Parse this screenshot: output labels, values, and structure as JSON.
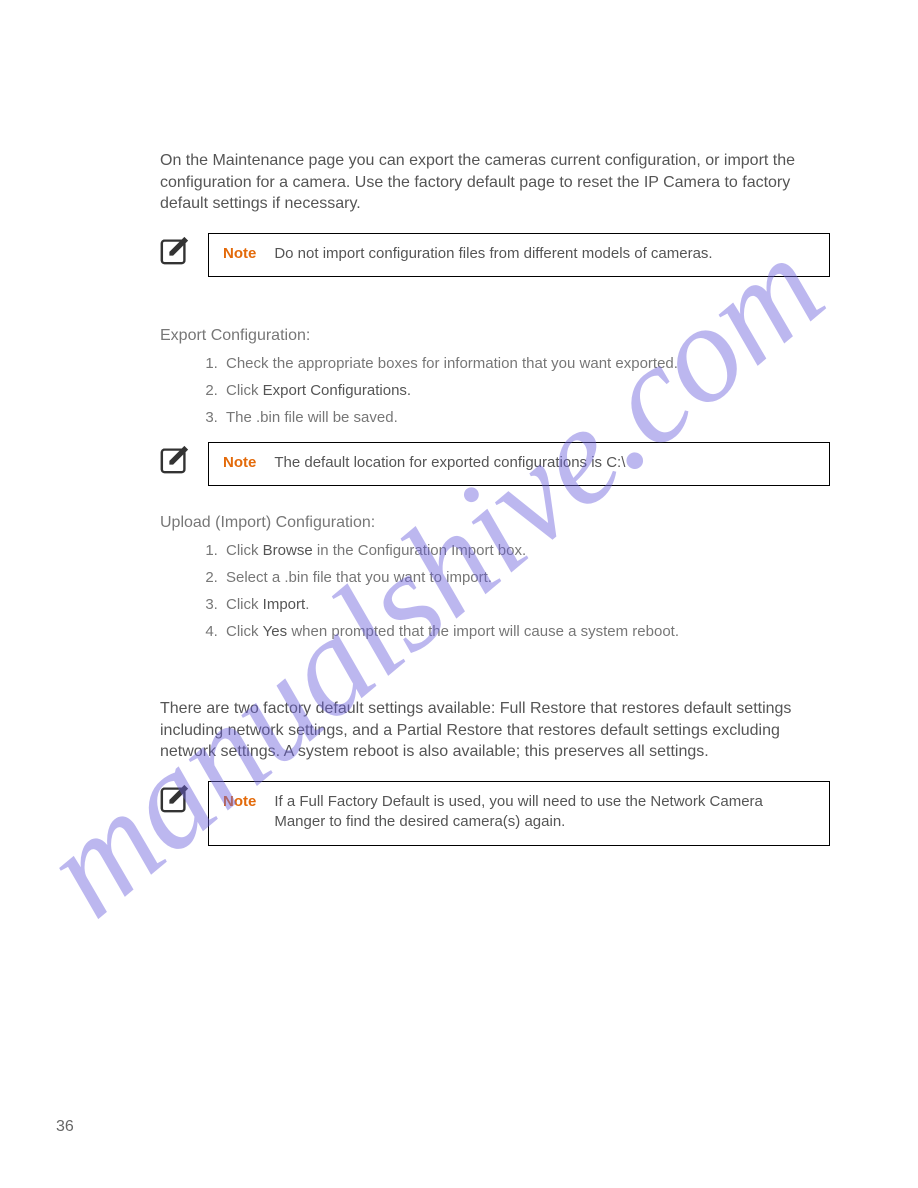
{
  "intro": "On the Maintenance page you can export the cameras current configuration, or import the configuration for a camera. Use the factory default page to reset the IP Camera to factory default settings if necessary.",
  "notes": {
    "label": "Note",
    "note1": "Do not import configuration files from different models of cameras.",
    "note2": "The default location for exported configurations is C:\\",
    "note3": "If a Full Factory Default is used, you will need to use the Network Camera Manger to find the desired camera(s) again."
  },
  "export": {
    "heading": "Export Configuration:",
    "steps": {
      "s1": "Check the appropriate boxes for information that you want exported.",
      "s2_prefix": "Click ",
      "s2_bold": "Export Configurations.",
      "s3": "The .bin file will be saved."
    }
  },
  "upload": {
    "heading": "Upload (Import) Configuration:",
    "steps": {
      "s1_prefix": "Click ",
      "s1_bold": "Browse",
      "s1_suffix": " in the Configuration Import box.",
      "s2": "Select a .bin file that you want to import.",
      "s3_prefix": "Click ",
      "s3_bold": "Import",
      "s3_suffix": ".",
      "s4_prefix": "Click ",
      "s4_bold": "Yes",
      "s4_suffix": " when prompted that the import will cause a system reboot."
    }
  },
  "factory_para": "There are two factory default settings available: Full Restore that restores default settings including network settings, and a Partial Restore that restores default settings excluding network settings. A system reboot is also available; this preserves all settings.",
  "page_number": "36",
  "watermark": "manualshive.com"
}
